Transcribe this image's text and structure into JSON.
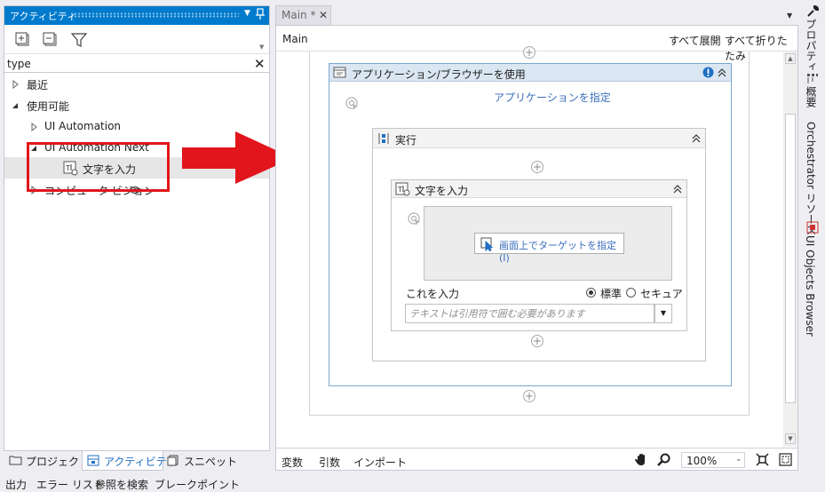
{
  "activities_panel": {
    "title": "アクティビティ",
    "search": {
      "value": "type",
      "placeholder": ""
    },
    "tree": [
      {
        "label": "最近",
        "expanded": false
      },
      {
        "label": "使用可能",
        "expanded": true
      },
      {
        "label": "UI Automation",
        "expanded": false
      },
      {
        "label": "UI Automation Next",
        "expanded": true
      },
      {
        "label": "文字を入力",
        "selected": true
      },
      {
        "label": "コンピュータ ビジョン",
        "expanded": false
      }
    ]
  },
  "left_tabs": [
    "プロジェクト",
    "アクティビティ",
    "スニペット"
  ],
  "bottom_tabs": [
    "出力",
    "エラー リスト",
    "参照を検索",
    "ブレークポイント"
  ],
  "document": {
    "tab_label": "Main *",
    "breadcrumb": "Main",
    "expand_all": "すべて展開",
    "collapse_all": "すべて折りたたみ"
  },
  "workflow": {
    "use_app_title": "アプリケーション/ブラウザーを使用",
    "indicate_app": "アプリケーションを指定",
    "do_title": "実行",
    "type_into_title": "文字を入力",
    "indicate_target": "画面上でターゲットを指定 (I)",
    "enter_label": "これを入力",
    "radio_standard": "標準",
    "radio_secure": "セキュア",
    "radio_selected": "standard",
    "text_placeholder": "テキストは引用符で囲む必要があります"
  },
  "designer_footer": {
    "variables": "変数",
    "arguments": "引数",
    "imports": "インポート",
    "zoom": "100%"
  },
  "right_tabs": [
    "プロパティ",
    "概要",
    "Orchestrator リソース",
    "UI Objects Browser"
  ],
  "colors": {
    "accent": "#007acc",
    "highlight": "#e3151c",
    "link": "#3a6ebd",
    "warning": "#1f6fc5"
  }
}
